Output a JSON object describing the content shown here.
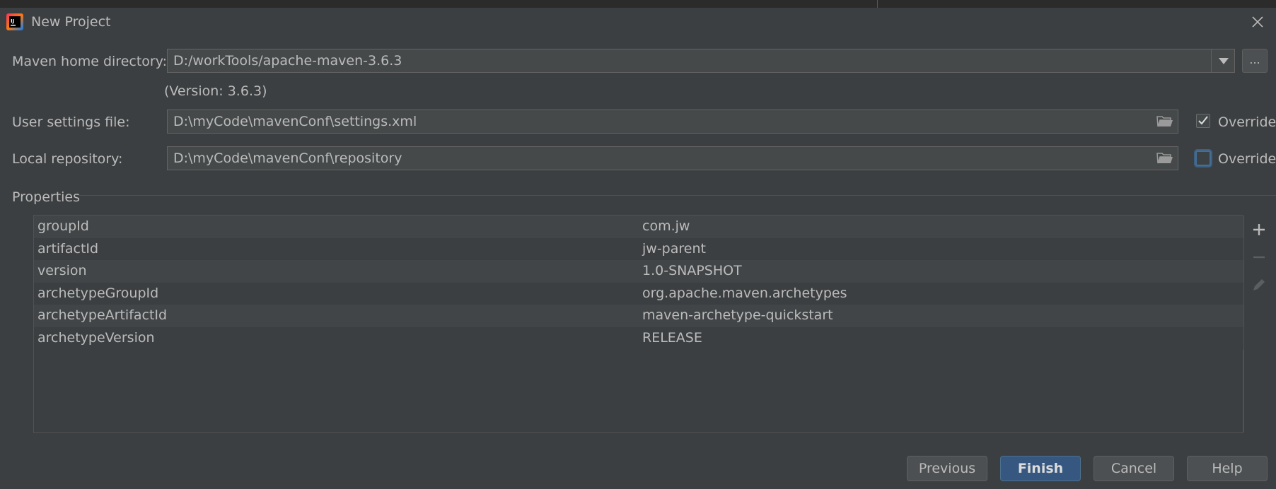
{
  "window": {
    "title": "New Project",
    "app_icon": "intellij-idea-icon",
    "close_icon": "close-icon"
  },
  "form": {
    "maven_home": {
      "label": "Maven home directory:",
      "value": "D:/workTools/apache-maven-3.6.3",
      "version_text": "(Version: 3.6.3)",
      "browse_label": "..."
    },
    "user_settings": {
      "label": "User settings file:",
      "value": "D:\\myCode\\mavenConf\\settings.xml",
      "override_label": "Override",
      "override_checked": true
    },
    "local_repository": {
      "label": "Local repository:",
      "value": "D:\\myCode\\mavenConf\\repository",
      "override_label": "Override",
      "override_checked": false
    }
  },
  "properties": {
    "section_label": "Properties",
    "rows": [
      {
        "key": "groupId",
        "value": "com.jw"
      },
      {
        "key": "artifactId",
        "value": "jw-parent"
      },
      {
        "key": "version",
        "value": "1.0-SNAPSHOT"
      },
      {
        "key": "archetypeGroupId",
        "value": "org.apache.maven.archetypes"
      },
      {
        "key": "archetypeArtifactId",
        "value": "maven-archetype-quickstart"
      },
      {
        "key": "archetypeVersion",
        "value": "RELEASE"
      }
    ],
    "tools": [
      "add-icon",
      "remove-icon",
      "edit-icon"
    ]
  },
  "buttons": {
    "previous": "Previous",
    "finish": "Finish",
    "cancel": "Cancel",
    "help": "Help"
  },
  "colors": {
    "background": "#3c3f41",
    "text": "#bbbbbb",
    "primary_button": "#365880",
    "focus_ring": "#466d94"
  }
}
